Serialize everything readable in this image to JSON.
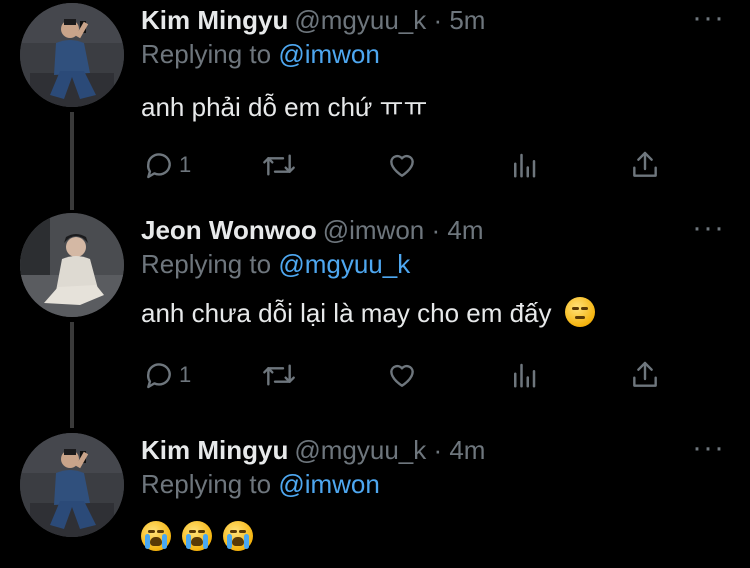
{
  "tweets": [
    {
      "name": "Kim Mingyu",
      "meta": "@mgyuu_k · 5m",
      "replying_prefix": "Replying to ",
      "replying_handle": "@imwon",
      "text": "anh phải dỗ em chứ ㅠㅠ",
      "reply_count": "1",
      "emoji": ""
    },
    {
      "name": "Jeon Wonwoo",
      "meta": "@imwon · 4m",
      "replying_prefix": "Replying to ",
      "replying_handle": "@mgyuu_k",
      "text": "anh chưa dỗi lại là may cho em đấy",
      "reply_count": "1",
      "emoji": "unamused-face"
    },
    {
      "name": "Kim Mingyu",
      "meta": "@mgyuu_k · 4m",
      "replying_prefix": "Replying to ",
      "replying_handle": "@imwon",
      "text": "",
      "emoji": "loudly-crying-face ×3"
    }
  ],
  "colors": {
    "background": "#000000",
    "text": "#e7e9ea",
    "muted": "#6e767d",
    "link": "#4ea7f0"
  },
  "icons": [
    "more-icon",
    "reply-icon",
    "retweet-icon",
    "like-icon",
    "analytics-icon",
    "share-icon"
  ]
}
